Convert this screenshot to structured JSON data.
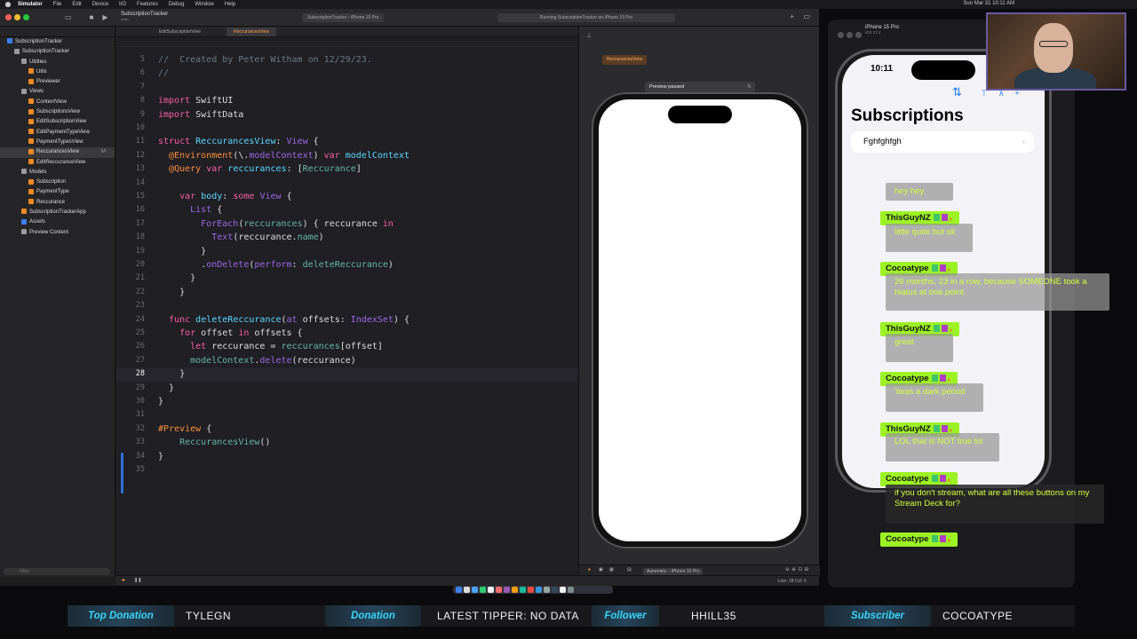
{
  "menubar": {
    "items": [
      "Simulator",
      "File",
      "Edit",
      "Device",
      "I/O",
      "Features",
      "Debug",
      "Window",
      "Help"
    ],
    "clock": "Sun Mar 31  10:11 AM"
  },
  "xcode": {
    "scheme": "SubscriptionTracker",
    "scheme_sub": "main",
    "destination": "SubscriptionTracker  ›  iPhone 15 Pro",
    "status": "Running SubscriptionTracker on iPhone 15 Pro",
    "tabs": [
      "EditSubscriptionView",
      "ReccurancesView"
    ],
    "navigator": [
      {
        "label": "SubscriptionTracker",
        "indent": 0,
        "color": "#3b82f6"
      },
      {
        "label": "SubscriptionTracker",
        "indent": 1,
        "color": "#9a9a9a"
      },
      {
        "label": "Utilities",
        "indent": 2,
        "color": "#9a9a9a"
      },
      {
        "label": "Utils",
        "indent": 3,
        "color": "#f08a24"
      },
      {
        "label": "Previewer",
        "indent": 3,
        "color": "#f08a24"
      },
      {
        "label": "Views",
        "indent": 2,
        "color": "#9a9a9a"
      },
      {
        "label": "ContentView",
        "indent": 3,
        "color": "#f08a24"
      },
      {
        "label": "SubscriptionsView",
        "indent": 3,
        "color": "#f08a24"
      },
      {
        "label": "EditSubscriptionView",
        "indent": 3,
        "color": "#f08a24"
      },
      {
        "label": "EditPaymentTypeView",
        "indent": 3,
        "color": "#f08a24"
      },
      {
        "label": "PaymentTypesView",
        "indent": 3,
        "color": "#f08a24"
      },
      {
        "label": "ReccurancesView",
        "indent": 3,
        "color": "#f08a24",
        "selected": true,
        "badge": "M"
      },
      {
        "label": "EditReccuranceView",
        "indent": 3,
        "color": "#f08a24"
      },
      {
        "label": "Models",
        "indent": 2,
        "color": "#9a9a9a"
      },
      {
        "label": "Subscription",
        "indent": 3,
        "color": "#f08a24"
      },
      {
        "label": "PaymentType",
        "indent": 3,
        "color": "#f08a24"
      },
      {
        "label": "Reccurance",
        "indent": 3,
        "color": "#f08a24"
      },
      {
        "label": "SubscriptionTrackerApp",
        "indent": 2,
        "color": "#f08a24"
      },
      {
        "label": "Assets",
        "indent": 2,
        "color": "#3b82f6"
      },
      {
        "label": "Preview Content",
        "indent": 2,
        "color": "#9a9a9a"
      }
    ],
    "filter_placeholder": "Filter",
    "code_lines": [
      {
        "n": "5",
        "html": "<span class=\"cm\">//  Created by Peter Witham on 12/29/23.</span>"
      },
      {
        "n": "6",
        "html": "<span class=\"cm\">//</span>"
      },
      {
        "n": "7",
        "html": ""
      },
      {
        "n": "8",
        "html": "<span class=\"kw\">import</span> SwiftUI"
      },
      {
        "n": "9",
        "html": "<span class=\"kw\">import</span> SwiftData"
      },
      {
        "n": "10",
        "html": ""
      },
      {
        "n": "11",
        "html": "<span class=\"kw\">struct</span> <span class=\"ty\">ReccurancesView</span>: <span class=\"pr\">View</span> {"
      },
      {
        "n": "12",
        "html": "  <span class=\"at\">@Environment</span>(\\.<span class=\"pr\">modelContext</span>) <span class=\"kw\">var</span> <span class=\"ty\">modelContext</span>"
      },
      {
        "n": "13",
        "html": "  <span class=\"at\">@Query</span> <span class=\"kw\">var</span> <span class=\"ty\">reccurances</span>: [<span class=\"fn\">Reccurance</span>]"
      },
      {
        "n": "14",
        "html": ""
      },
      {
        "n": "15",
        "html": "    <span class=\"kw\">var</span> <span class=\"ty\">body</span>: <span class=\"kw\">some</span> <span class=\"pr\">View</span> {"
      },
      {
        "n": "16",
        "html": "      <span class=\"pr\">List</span> {"
      },
      {
        "n": "17",
        "html": "        <span class=\"pr\">ForEach</span>(<span class=\"fn\">reccurances</span>) { reccurance <span class=\"kw\">in</span>"
      },
      {
        "n": "18",
        "html": "          <span class=\"pr\">Text</span>(reccurance.<span class=\"fn\">name</span>)"
      },
      {
        "n": "19",
        "html": "        }"
      },
      {
        "n": "20",
        "html": "        .<span class=\"pr\">onDelete</span>(<span class=\"pr\">perform</span>: <span class=\"fn\">deleteReccurance</span>)"
      },
      {
        "n": "21",
        "html": "      }"
      },
      {
        "n": "22",
        "html": "    }"
      },
      {
        "n": "23",
        "html": ""
      },
      {
        "n": "24",
        "html": "  <span class=\"kw\">func</span> <span class=\"ty\">deleteReccurance</span>(<span class=\"pr\">at</span> offsets: <span class=\"pr\">IndexSet</span>) {"
      },
      {
        "n": "25",
        "html": "    <span class=\"kw\">for</span> offset <span class=\"kw\">in</span> offsets {"
      },
      {
        "n": "26",
        "html": "      <span class=\"kw\">let</span> reccurance = <span class=\"fn\">reccurances</span>[offset]"
      },
      {
        "n": "27",
        "html": "      <span class=\"fn\">modelContext</span>.<span class=\"pr\">delete</span>(reccurance)"
      },
      {
        "n": "28",
        "html": "    }",
        "current": true
      },
      {
        "n": "29",
        "html": "  }"
      },
      {
        "n": "30",
        "html": "}"
      },
      {
        "n": "31",
        "html": ""
      },
      {
        "n": "32",
        "html": "<span class=\"at\">#Preview</span> {"
      },
      {
        "n": "33",
        "html": "    <span class=\"fn\">ReccurancesView</span>()"
      },
      {
        "n": "34",
        "html": "}"
      },
      {
        "n": "35",
        "html": ""
      }
    ],
    "canvas": {
      "chip": "ReccurancesView",
      "paused": "Preview paused",
      "device": "Automatic – iPhone 15 Pro"
    },
    "cursor_pos": "Line: 28  Col: 6"
  },
  "simulator": {
    "title": "iPhone 15 Pro",
    "subtitle": "iOS 17.4",
    "time": "10:11",
    "nav_title": "Subscriptions",
    "rows": [
      "Fghfghfgh"
    ]
  },
  "chat": [
    {
      "kind": "msg",
      "text": "hey hey",
      "style": "grey"
    },
    {
      "kind": "name",
      "text": "ThisGuyNZ"
    },
    {
      "kind": "msg",
      "text": "little quite but ok",
      "style": "grey"
    },
    {
      "kind": "name",
      "text": "Cocoatype"
    },
    {
      "kind": "msg",
      "text": "26 months, 23 in a row, because SOMEONE took a hiatus at one point.",
      "style": "grey"
    },
    {
      "kind": "name",
      "text": "ThisGuyNZ"
    },
    {
      "kind": "msg",
      "text": "great",
      "style": "grey"
    },
    {
      "kind": "name",
      "text": "Cocoatype"
    },
    {
      "kind": "msg",
      "text": "'twas a dark period",
      "style": "grey"
    },
    {
      "kind": "name",
      "text": "ThisGuyNZ"
    },
    {
      "kind": "msg",
      "text": "LOL that is NOT true lol",
      "style": "grey"
    },
    {
      "kind": "name",
      "text": "Cocoatype"
    },
    {
      "kind": "msg",
      "text": "if you don't stream, what are all these buttons on my Stream Deck for?",
      "style": "dark"
    },
    {
      "kind": "name",
      "text": "Cocoatype"
    }
  ],
  "ticker": {
    "top_donation_label": "Top Donation",
    "top_donation_value": "TYLEGN",
    "donation_label": "Donation",
    "donation_value": "LATEST TIPPER: NO DATA",
    "follower_label": "Follower",
    "follower_value": "HHILL35",
    "subscriber_label": "Subscriber",
    "subscriber_value": "COCOATYPE"
  },
  "colors": {
    "chat_name_bg": "#9df224",
    "chat_text": "#d5ff3d",
    "ticker_label": "#37d4f5",
    "xcode_accent": "#ff9c4a",
    "ios_blue": "#1f7aff"
  }
}
